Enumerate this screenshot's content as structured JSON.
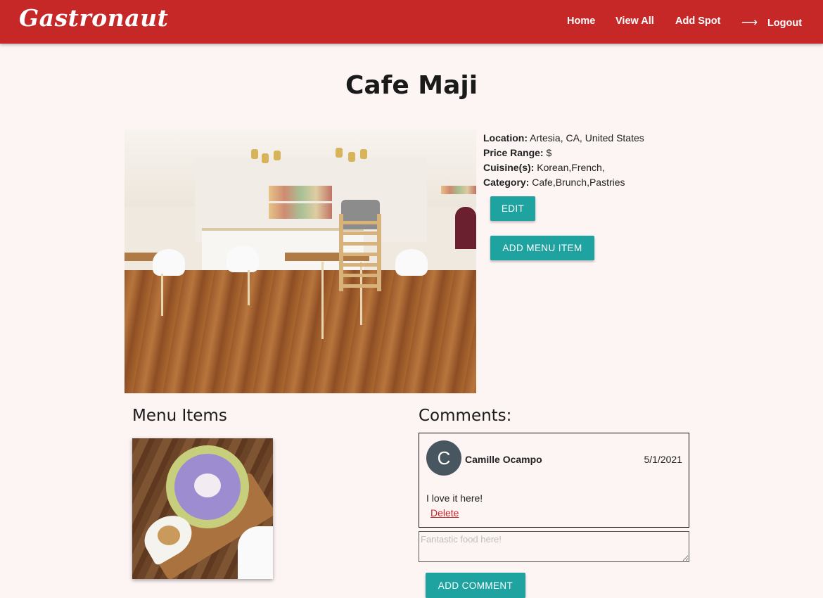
{
  "app": {
    "brand": "Gastronaut"
  },
  "nav": {
    "home": "Home",
    "view_all": "View All",
    "add_spot": "Add Spot",
    "logout": "Logout",
    "logout_icon": "right-arrow-icon"
  },
  "spot": {
    "name": "Cafe Maji",
    "location_label": "Location:",
    "location": "Artesia, CA, United States",
    "price_label": "Price Range:",
    "price": "$",
    "cuisine_label": "Cuisine(s):",
    "cuisine": "Korean,French,",
    "category_label": "Category:",
    "category": "Cafe,Brunch,Pastries"
  },
  "actions": {
    "edit": "Edit",
    "add_menu_item": "Add Menu Item"
  },
  "menu": {
    "heading": "Menu Items"
  },
  "comments": {
    "heading": "Comments:",
    "items": [
      {
        "avatar_initial": "C",
        "author": "Camille Ocampo",
        "date": "5/1/2021",
        "text": "I love it here!",
        "delete_label": "Delete"
      }
    ],
    "input_placeholder": "Fantastic food here!",
    "submit_label": "Add Comment"
  },
  "colors": {
    "navbar": "#c62828",
    "accent": "#1fa3a0",
    "background": "#fdf4f4"
  }
}
